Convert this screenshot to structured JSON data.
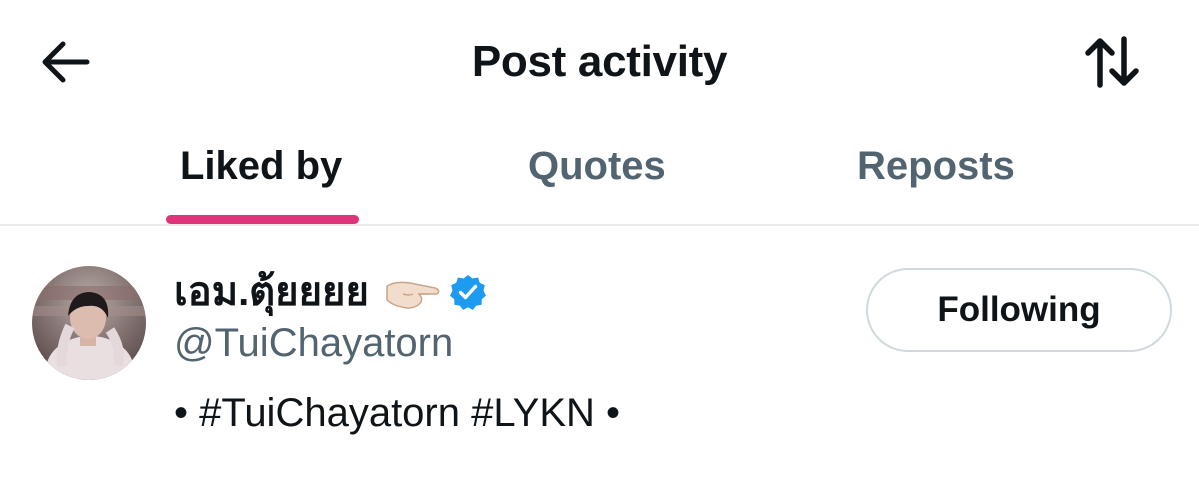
{
  "header": {
    "title": "Post activity",
    "back_icon": "arrow-left-icon",
    "sort_icon": "sort-arrows-icon"
  },
  "tabs": [
    {
      "label": "Liked by",
      "active": true
    },
    {
      "label": "Quotes",
      "active": false
    },
    {
      "label": "Reposts",
      "active": false
    }
  ],
  "users": [
    {
      "display_name": "เอม.ตุ้ยยยย",
      "emoji_icon": "pointing-hand-icon",
      "verified": true,
      "handle": "@TuiChayatorn",
      "bio": "• #TuiChayatorn #LYKN •",
      "follow_label": "Following"
    }
  ],
  "colors": {
    "text_primary": "#0f1419",
    "text_secondary": "#536471",
    "tab_indicator": "#e0347a",
    "verified": "#1d9bf0",
    "divider": "#e7e9ea",
    "button_border": "#cfd9de"
  }
}
